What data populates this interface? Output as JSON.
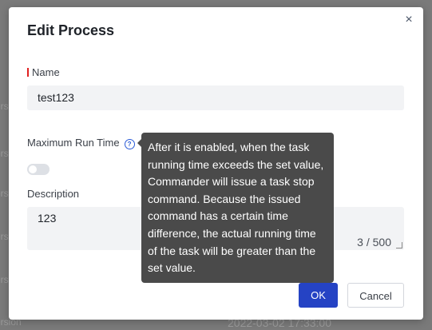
{
  "background": {
    "side_labels": [
      "ersion",
      "ersion",
      "ersion",
      "ersion",
      "ersion",
      "ersion",
      "ersion"
    ],
    "footer_timestamp": "2022-03-02 17:33:00",
    "footer_label": "ersion"
  },
  "dialog": {
    "title": "Edit Process",
    "close_icon": "×",
    "name_label": "Name",
    "name_value": "test123",
    "max_run_time_label": "Maximum Run Time",
    "help_icon": "?",
    "toggle_on": false,
    "description_label": "Description",
    "description_value": "123",
    "description_counter": "3 / 500",
    "ok_label": "OK",
    "cancel_label": "Cancel"
  },
  "tooltip": {
    "text": "After it is enabled, when the task running time exceeds the set value, Commander will issue a task stop command. Because the issued command has a certain time difference, the actual running time of the task will be greater than the set value."
  },
  "colors": {
    "primary": "#2543c4",
    "required": "#e02020",
    "tooltip_bg": "#4a4a4a",
    "overlay": "#7a7a7a"
  }
}
